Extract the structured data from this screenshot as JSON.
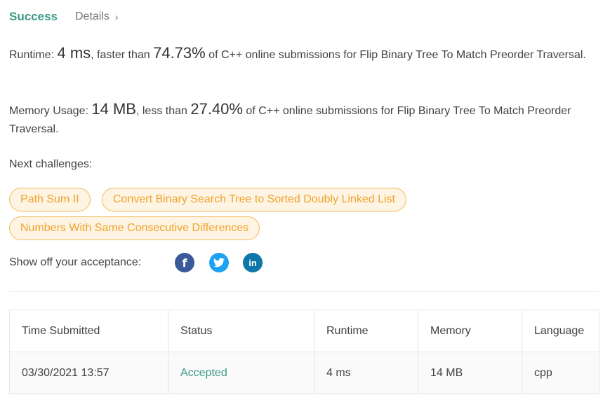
{
  "header": {
    "status": "Success",
    "details_label": "Details",
    "chevron": "›"
  },
  "runtime": {
    "prefix": "Runtime: ",
    "value": "4 ms",
    "middle": ", faster than ",
    "percent": "74.73%",
    "suffix": " of C++ online submissions for Flip Binary Tree To Match Preorder Traversal."
  },
  "memory": {
    "prefix": "Memory Usage: ",
    "value": "14 MB",
    "middle": ", less than ",
    "percent": "27.40%",
    "suffix": " of C++ online submissions for Flip Binary Tree To Match Preorder Traversal."
  },
  "next_challenges": {
    "label": "Next challenges:",
    "items": [
      "Path Sum II",
      "Convert Binary Search Tree to Sorted Doubly Linked List",
      "Numbers With Same Consecutive Differences"
    ]
  },
  "share": {
    "label": "Show off your acceptance:",
    "icons": [
      "facebook-icon",
      "twitter-icon",
      "linkedin-icon"
    ],
    "glyphs": {
      "facebook": "f",
      "linkedin": "in"
    }
  },
  "table": {
    "headers": [
      "Time Submitted",
      "Status",
      "Runtime",
      "Memory",
      "Language"
    ],
    "rows": [
      [
        "03/30/2021 13:57",
        "Accepted",
        "4 ms",
        "14 MB",
        "cpp"
      ]
    ]
  },
  "colors": {
    "success": "#3a9a86",
    "chip_text": "#f0a22c",
    "chip_bg": "#fef4e3",
    "facebook": "#3b5998",
    "twitter": "#1da1f2",
    "linkedin": "#0e76a8"
  }
}
